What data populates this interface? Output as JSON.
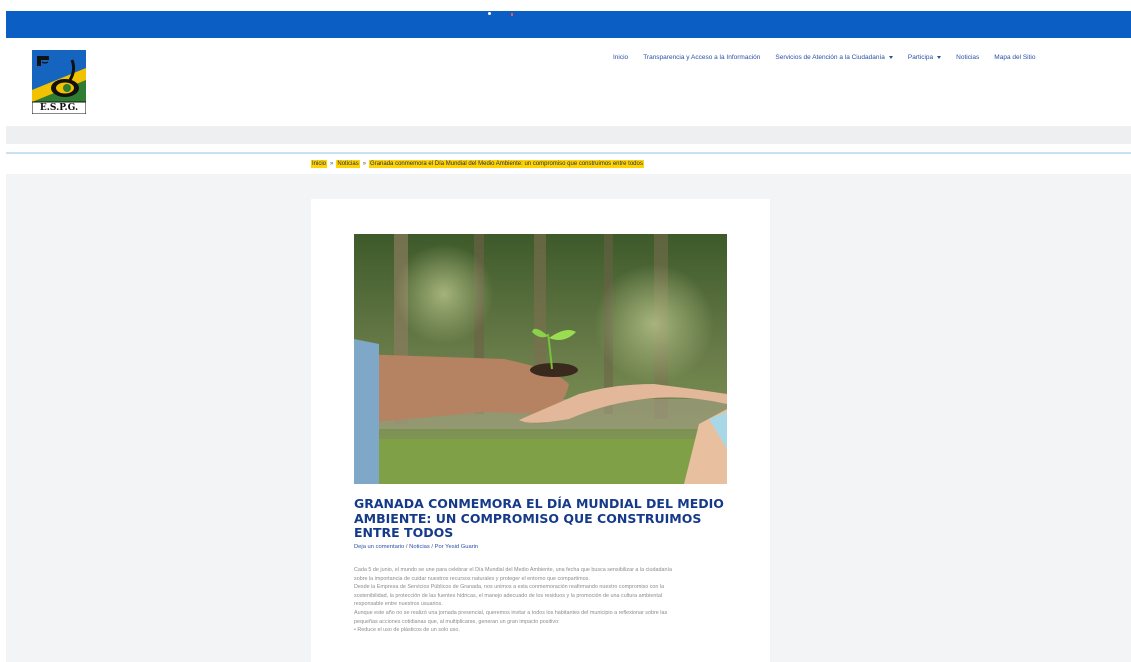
{
  "logo": {
    "text": "E.S.P.G."
  },
  "nav": {
    "items": [
      {
        "label": "Inicio",
        "dropdown": false
      },
      {
        "label": "Transparencia y Acceso a la Información",
        "dropdown": false
      },
      {
        "label": "Servicios de Atención a la Ciudadanía",
        "dropdown": true
      },
      {
        "label": "Participa",
        "dropdown": true
      },
      {
        "label": "Noticias",
        "dropdown": false
      },
      {
        "label": "Mapa del Sitio",
        "dropdown": false
      }
    ]
  },
  "breadcrumb": {
    "items": [
      "Inicio",
      "Noticias",
      "Granada conmemora el Día Mundial del Medio Ambiente: un compromiso que construimos entre todos"
    ],
    "separator": "»"
  },
  "post": {
    "title": "GRANADA CONMEMORA EL DÍA MUNDIAL DEL MEDIO AMBIENTE: UN COMPROMISO QUE CONSTRUIMOS ENTRE TODOS",
    "meta": {
      "comment": "Deja un comentario",
      "category": "Noticias",
      "author": "Por Yesid Guarin",
      "separator": "/"
    },
    "paragraphs": [
      "Cada 5 de junio, el mundo se une para celebrar el Día Mundial del Medio Ambiente, una fecha que busca sensibilizar a la ciudadanía",
      "sobre la importancia de cuidar nuestros recursos naturales y proteger el entorno que compartimos.",
      "Desde la Empresa de Servicios Públicos de Granada, nos unimos a esta conmemoración reafirmando nuestro compromiso con la",
      "sostenibilidad, la protección de las fuentes hídricas, el manejo adecuado de los residuos y la promoción de una cultura ambiental",
      "responsable entre nuestros usuarios.",
      "Aunque este año no se realizó una jornada presencial, queremos invitar a todos los habitantes del municipio a reflexionar sobre las",
      "pequeñas acciones cotidianas que, al multiplicarse, generan un gran impacto positivo:",
      "• Reduce el uso de plásticos de un solo uso."
    ]
  },
  "colors": {
    "top_bar": "#0a5ec4",
    "nav_link": "#2a4fa8",
    "title": "#153a8a",
    "breadcrumb_highlight": "#ffd400"
  }
}
